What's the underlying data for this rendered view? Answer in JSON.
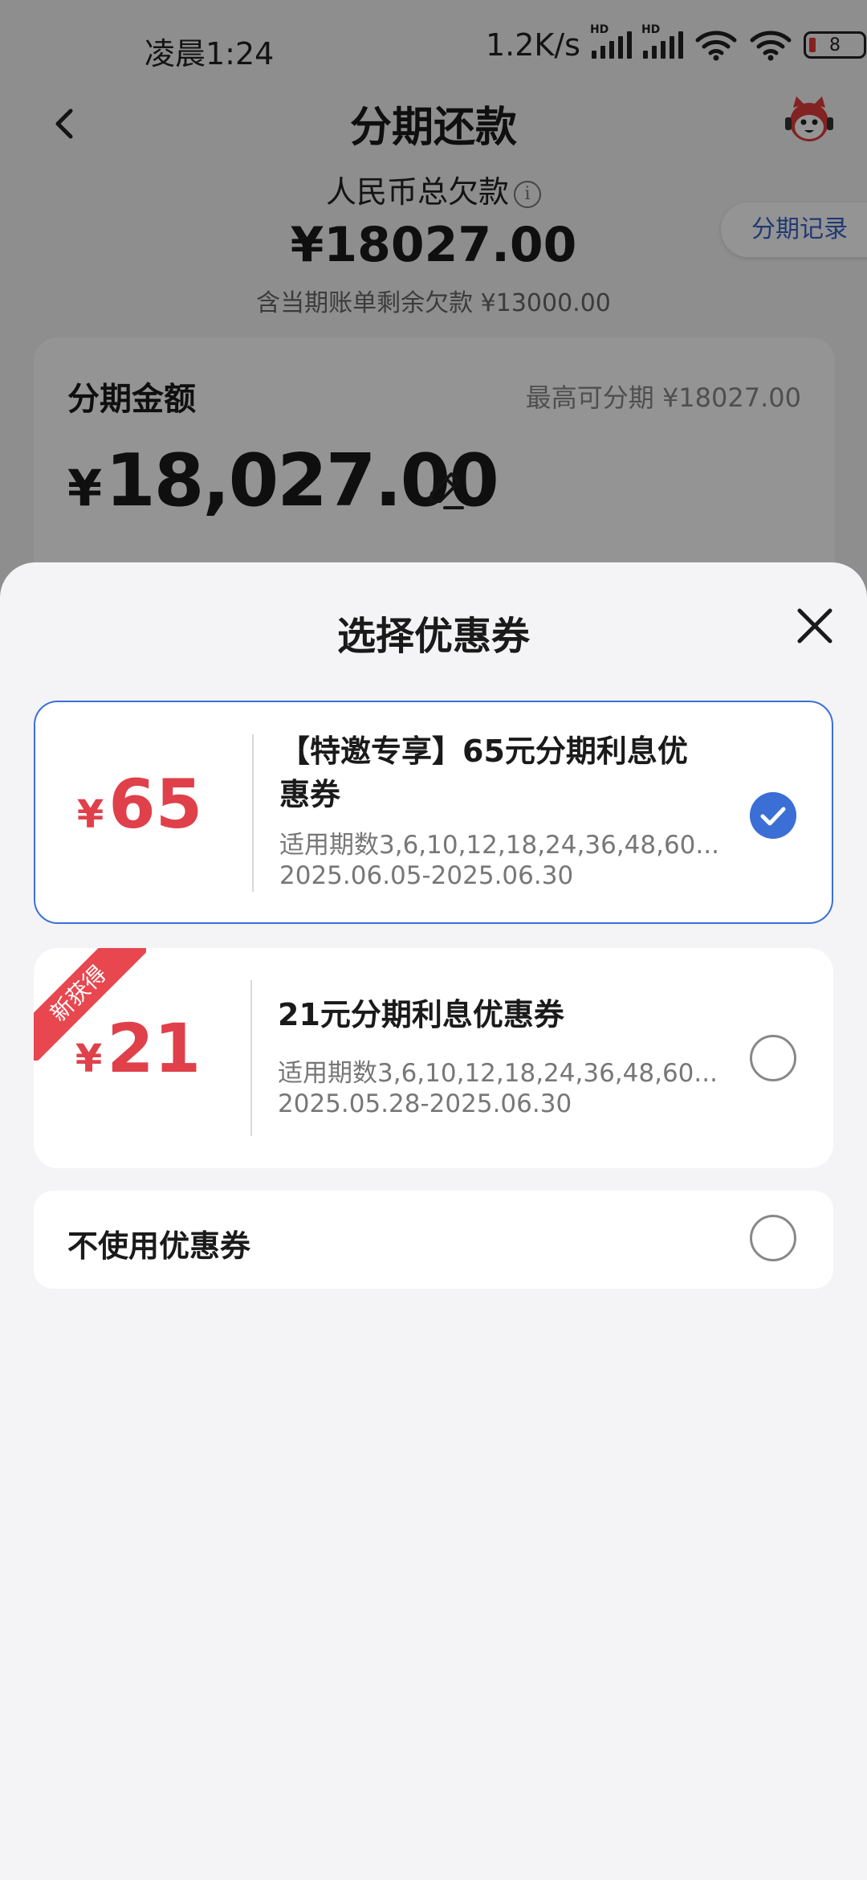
{
  "status_bar": {
    "time": "凌晨1:24",
    "speed": "1.2K/s",
    "signal_label": "HD",
    "battery": "8"
  },
  "header": {
    "title": "分期还款",
    "back_icon": "chevron-left-icon",
    "mascot_icon": "customer-service-mascot-icon"
  },
  "debt": {
    "label": "人民币总欠款",
    "amount": "¥18027.00",
    "sub": "含当期账单剩余欠款 ¥13000.00",
    "records_button": "分期记录"
  },
  "installment": {
    "label": "分期金额",
    "max": "最高可分期 ¥18027.00",
    "currency": "¥",
    "amount": "18,027.00"
  },
  "sheet": {
    "title": "选择优惠券",
    "coupons": [
      {
        "yen": "¥",
        "value": "65",
        "title": "【特邀专享】65元分期利息优惠券",
        "periods": "适用期数3,6,10,12,18,24,36,48,60...",
        "dates": "2025.06.05-2025.06.30",
        "selected": true
      },
      {
        "yen": "¥",
        "value": "21",
        "badge": "新获得",
        "title": "21元分期利息优惠券",
        "periods": "适用期数3,6,10,12,18,24,36,48,60...",
        "dates": "2025.05.28-2025.06.30",
        "selected": false
      }
    ],
    "no_coupon_label": "不使用优惠券"
  },
  "colors": {
    "accent_blue": "#3b6fd6",
    "coupon_red": "#e0404a",
    "badge_red": "#e8474f"
  }
}
